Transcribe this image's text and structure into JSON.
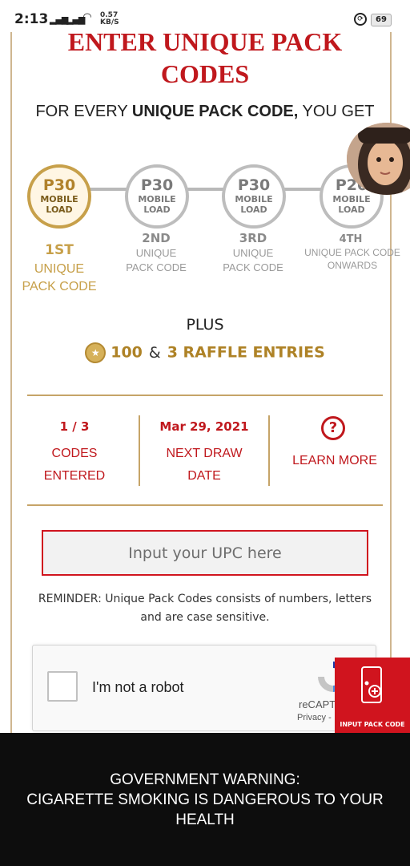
{
  "status_bar": {
    "time": "2:13",
    "net_speed": "0.57",
    "net_speed_unit": "KB/S",
    "battery": "69"
  },
  "header": {
    "title_line1": "ENTER UNIQUE PACK",
    "title_line2": "CODES",
    "subtitle_pre": "FOR EVERY ",
    "subtitle_bold": "UNIQUE PACK CODE,",
    "subtitle_post": " YOU GET"
  },
  "steps": [
    {
      "amount": "P30",
      "reward": [
        "MOBILE",
        "LOAD"
      ],
      "ordinal": "1ST",
      "desc": [
        "UNIQUE",
        "PACK CODE"
      ]
    },
    {
      "amount": "P30",
      "reward": [
        "MOBILE",
        "LOAD"
      ],
      "ordinal": "2ND",
      "desc": [
        "UNIQUE",
        "PACK CODE"
      ]
    },
    {
      "amount": "P30",
      "reward": [
        "MOBILE",
        "LOAD"
      ],
      "ordinal": "3RD",
      "desc": [
        "UNIQUE",
        "PACK CODE"
      ]
    },
    {
      "amount": "P20",
      "reward": [
        "MOBILE",
        "LOAD"
      ],
      "ordinal": "4TH",
      "desc": [
        "UNIQUE PACK CODE",
        "ONWARDS"
      ]
    }
  ],
  "bonus": {
    "plus_label": "PLUS",
    "points": "100",
    "amp": "&",
    "raffle": "3 RAFFLE ENTRIES"
  },
  "stats": {
    "codes_value": "1 / 3",
    "codes_label": [
      "CODES",
      "ENTERED"
    ],
    "draw_value": "Mar 29, 2021",
    "draw_label": [
      "NEXT DRAW",
      "DATE"
    ],
    "learn_more": "LEARN MORE"
  },
  "upc": {
    "placeholder": "Input your UPC here",
    "reminder": "REMINDER: Unique Pack Codes consists of numbers, letters and are case sensitive."
  },
  "captcha": {
    "label": "I'm not a robot",
    "brand": "reCAPT",
    "privacy": "Privacy -"
  },
  "fab": {
    "label": "INPUT PACK CODE"
  },
  "warning": {
    "line1": "GOVERNMENT WARNING:",
    "line2": "CIGARETTE SMOKING IS DANGEROUS TO YOUR",
    "line3": "HEALTH"
  },
  "colors": {
    "accent_red": "#c0181d",
    "gold": "#c7a04a",
    "warning_bg": "#0d0d0d"
  }
}
